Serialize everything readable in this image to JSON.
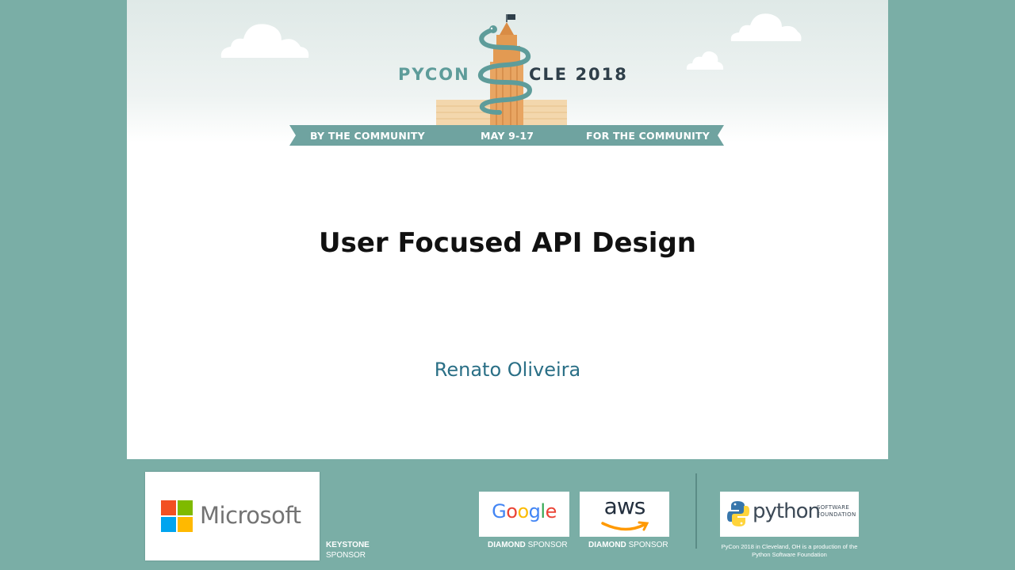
{
  "header": {
    "brand_left": "PYCON",
    "brand_right": "CLE 2018",
    "ribbon_left": "BY THE COMMUNITY",
    "ribbon_center": "MAY 9-17",
    "ribbon_right": "FOR THE COMMUNITY"
  },
  "slide": {
    "title": "User Focused API Design",
    "speaker": "Renato Oliveira"
  },
  "sponsors": {
    "keystone": {
      "logo_text": "Microsoft",
      "tier": "KEYSTONE",
      "tier_suffix": "SPONSOR"
    },
    "google": {
      "logo_text": "Google",
      "tier": "DIAMOND",
      "tier_suffix": "SPONSOR"
    },
    "aws": {
      "logo_text": "aws",
      "tier": "DIAMOND",
      "tier_suffix": "SPONSOR"
    },
    "psf": {
      "logo_text": "python",
      "logo_sub_1": "SOFTWARE",
      "logo_sub_2": "FOUNDATION",
      "note_1": "PyCon 2018 in Cleveland, OH is a production of the",
      "note_2": "Python Software Foundation"
    }
  },
  "colors": {
    "background": "#7aaea6",
    "accent_teal": "#5e9c9a",
    "speaker": "#2a6f86",
    "ms_red": "#f25022",
    "ms_green": "#7fba00",
    "ms_blue": "#00a4ef",
    "ms_yellow": "#ffb900"
  },
  "icons": [
    "cloud-icon",
    "tower-snake-icon",
    "microsoft-logo-icon",
    "aws-smile-icon",
    "python-logo-icon"
  ]
}
